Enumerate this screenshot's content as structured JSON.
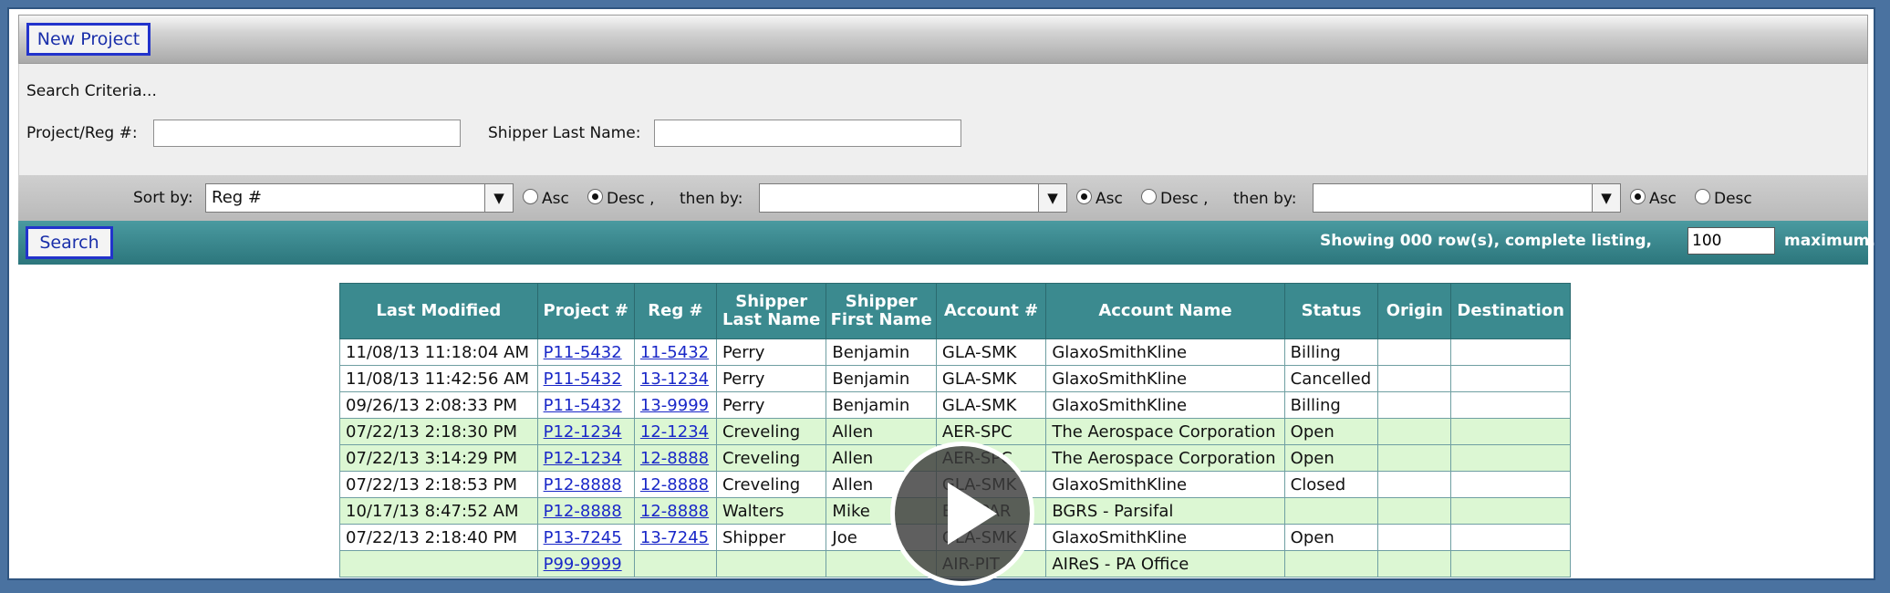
{
  "toolbar": {
    "new_project_label": "New Project"
  },
  "criteria": {
    "heading": "Search Criteria...",
    "project_reg_label": "Project/Reg #:",
    "project_reg_value": "",
    "shipper_last_label": "Shipper Last Name:",
    "shipper_last_value": ""
  },
  "sort": {
    "sort_by_label": "Sort by:",
    "sort1_value": "Reg #",
    "then_by_label": "then by:",
    "sort2_value": "",
    "sort3_value": "",
    "asc_label": "Asc",
    "desc_label": "Desc ,",
    "desc_last_label": "Desc",
    "sort1_order": "desc",
    "sort2_order": "asc",
    "sort3_order": "asc"
  },
  "search": {
    "search_label": "Search",
    "showing_prefix": "Showing 000 row(s), complete listing,",
    "max_value": "100",
    "max_suffix": "maximum."
  },
  "table": {
    "headers": [
      "Last Modified",
      "Project #",
      "Reg #",
      "Shipper Last Name",
      "Shipper First Name",
      "Account #",
      "Account Name",
      "Status",
      "Origin",
      "Destination"
    ],
    "rows": [
      {
        "modified": "11/08/13 11:18:04 AM",
        "project": "P11-5432",
        "reg": "11-5432",
        "last": "Perry",
        "first": "Benjamin",
        "account": "GLA-SMK",
        "name": "GlaxoSmithKline",
        "status": "Billing",
        "origin": "",
        "dest": "",
        "style": "white"
      },
      {
        "modified": "11/08/13 11:42:56 AM",
        "project": "P11-5432",
        "reg": "13-1234",
        "last": "Perry",
        "first": "Benjamin",
        "account": "GLA-SMK",
        "name": "GlaxoSmithKline",
        "status": "Cancelled",
        "origin": "",
        "dest": "",
        "style": "white"
      },
      {
        "modified": "09/26/13 2:08:33 PM",
        "project": "P11-5432",
        "reg": "13-9999",
        "last": "Perry",
        "first": "Benjamin",
        "account": "GLA-SMK",
        "name": "GlaxoSmithKline",
        "status": "Billing",
        "origin": "",
        "dest": "",
        "style": "white"
      },
      {
        "modified": "07/22/13 2:18:30 PM",
        "project": "P12-1234",
        "reg": "12-1234",
        "last": "Creveling",
        "first": "Allen",
        "account": "AER-SPC",
        "name": "The Aerospace Corporation",
        "status": "Open",
        "origin": "",
        "dest": "",
        "style": "green"
      },
      {
        "modified": "07/22/13 3:14:29 PM",
        "project": "P12-1234",
        "reg": "12-8888",
        "last": "Creveling",
        "first": "Allen",
        "account": "AER-SPC",
        "name": "The Aerospace Corporation",
        "status": "Open",
        "origin": "",
        "dest": "",
        "style": "green"
      },
      {
        "modified": "07/22/13 2:18:53 PM",
        "project": "P12-8888",
        "reg": "12-8888",
        "last": "Creveling",
        "first": "Allen",
        "account": "GLA-SMK",
        "name": "GlaxoSmithKline",
        "status": "Closed",
        "origin": "",
        "dest": "",
        "style": "white"
      },
      {
        "modified": "10/17/13 8:47:52 AM",
        "project": "P12-8888",
        "reg": "12-8888",
        "last": "Walters",
        "first": "Mike",
        "account": "BKF-PAR",
        "name": "BGRS - Parsifal",
        "status": "",
        "origin": "",
        "dest": "",
        "style": "green"
      },
      {
        "modified": "07/22/13 2:18:40 PM",
        "project": "P13-7245",
        "reg": "13-7245",
        "last": "Shipper",
        "first": "Joe",
        "account": "GLA-SMK",
        "name": "GlaxoSmithKline",
        "status": "Open",
        "origin": "",
        "dest": "",
        "style": "white"
      },
      {
        "modified": "",
        "project": "P99-9999",
        "reg": "",
        "last": "",
        "first": "",
        "account": "AIR-PIT",
        "name": "AIReS - PA Office",
        "status": "",
        "origin": "",
        "dest": "",
        "style": "green"
      }
    ]
  },
  "overlay": {
    "icon": "play-icon"
  }
}
